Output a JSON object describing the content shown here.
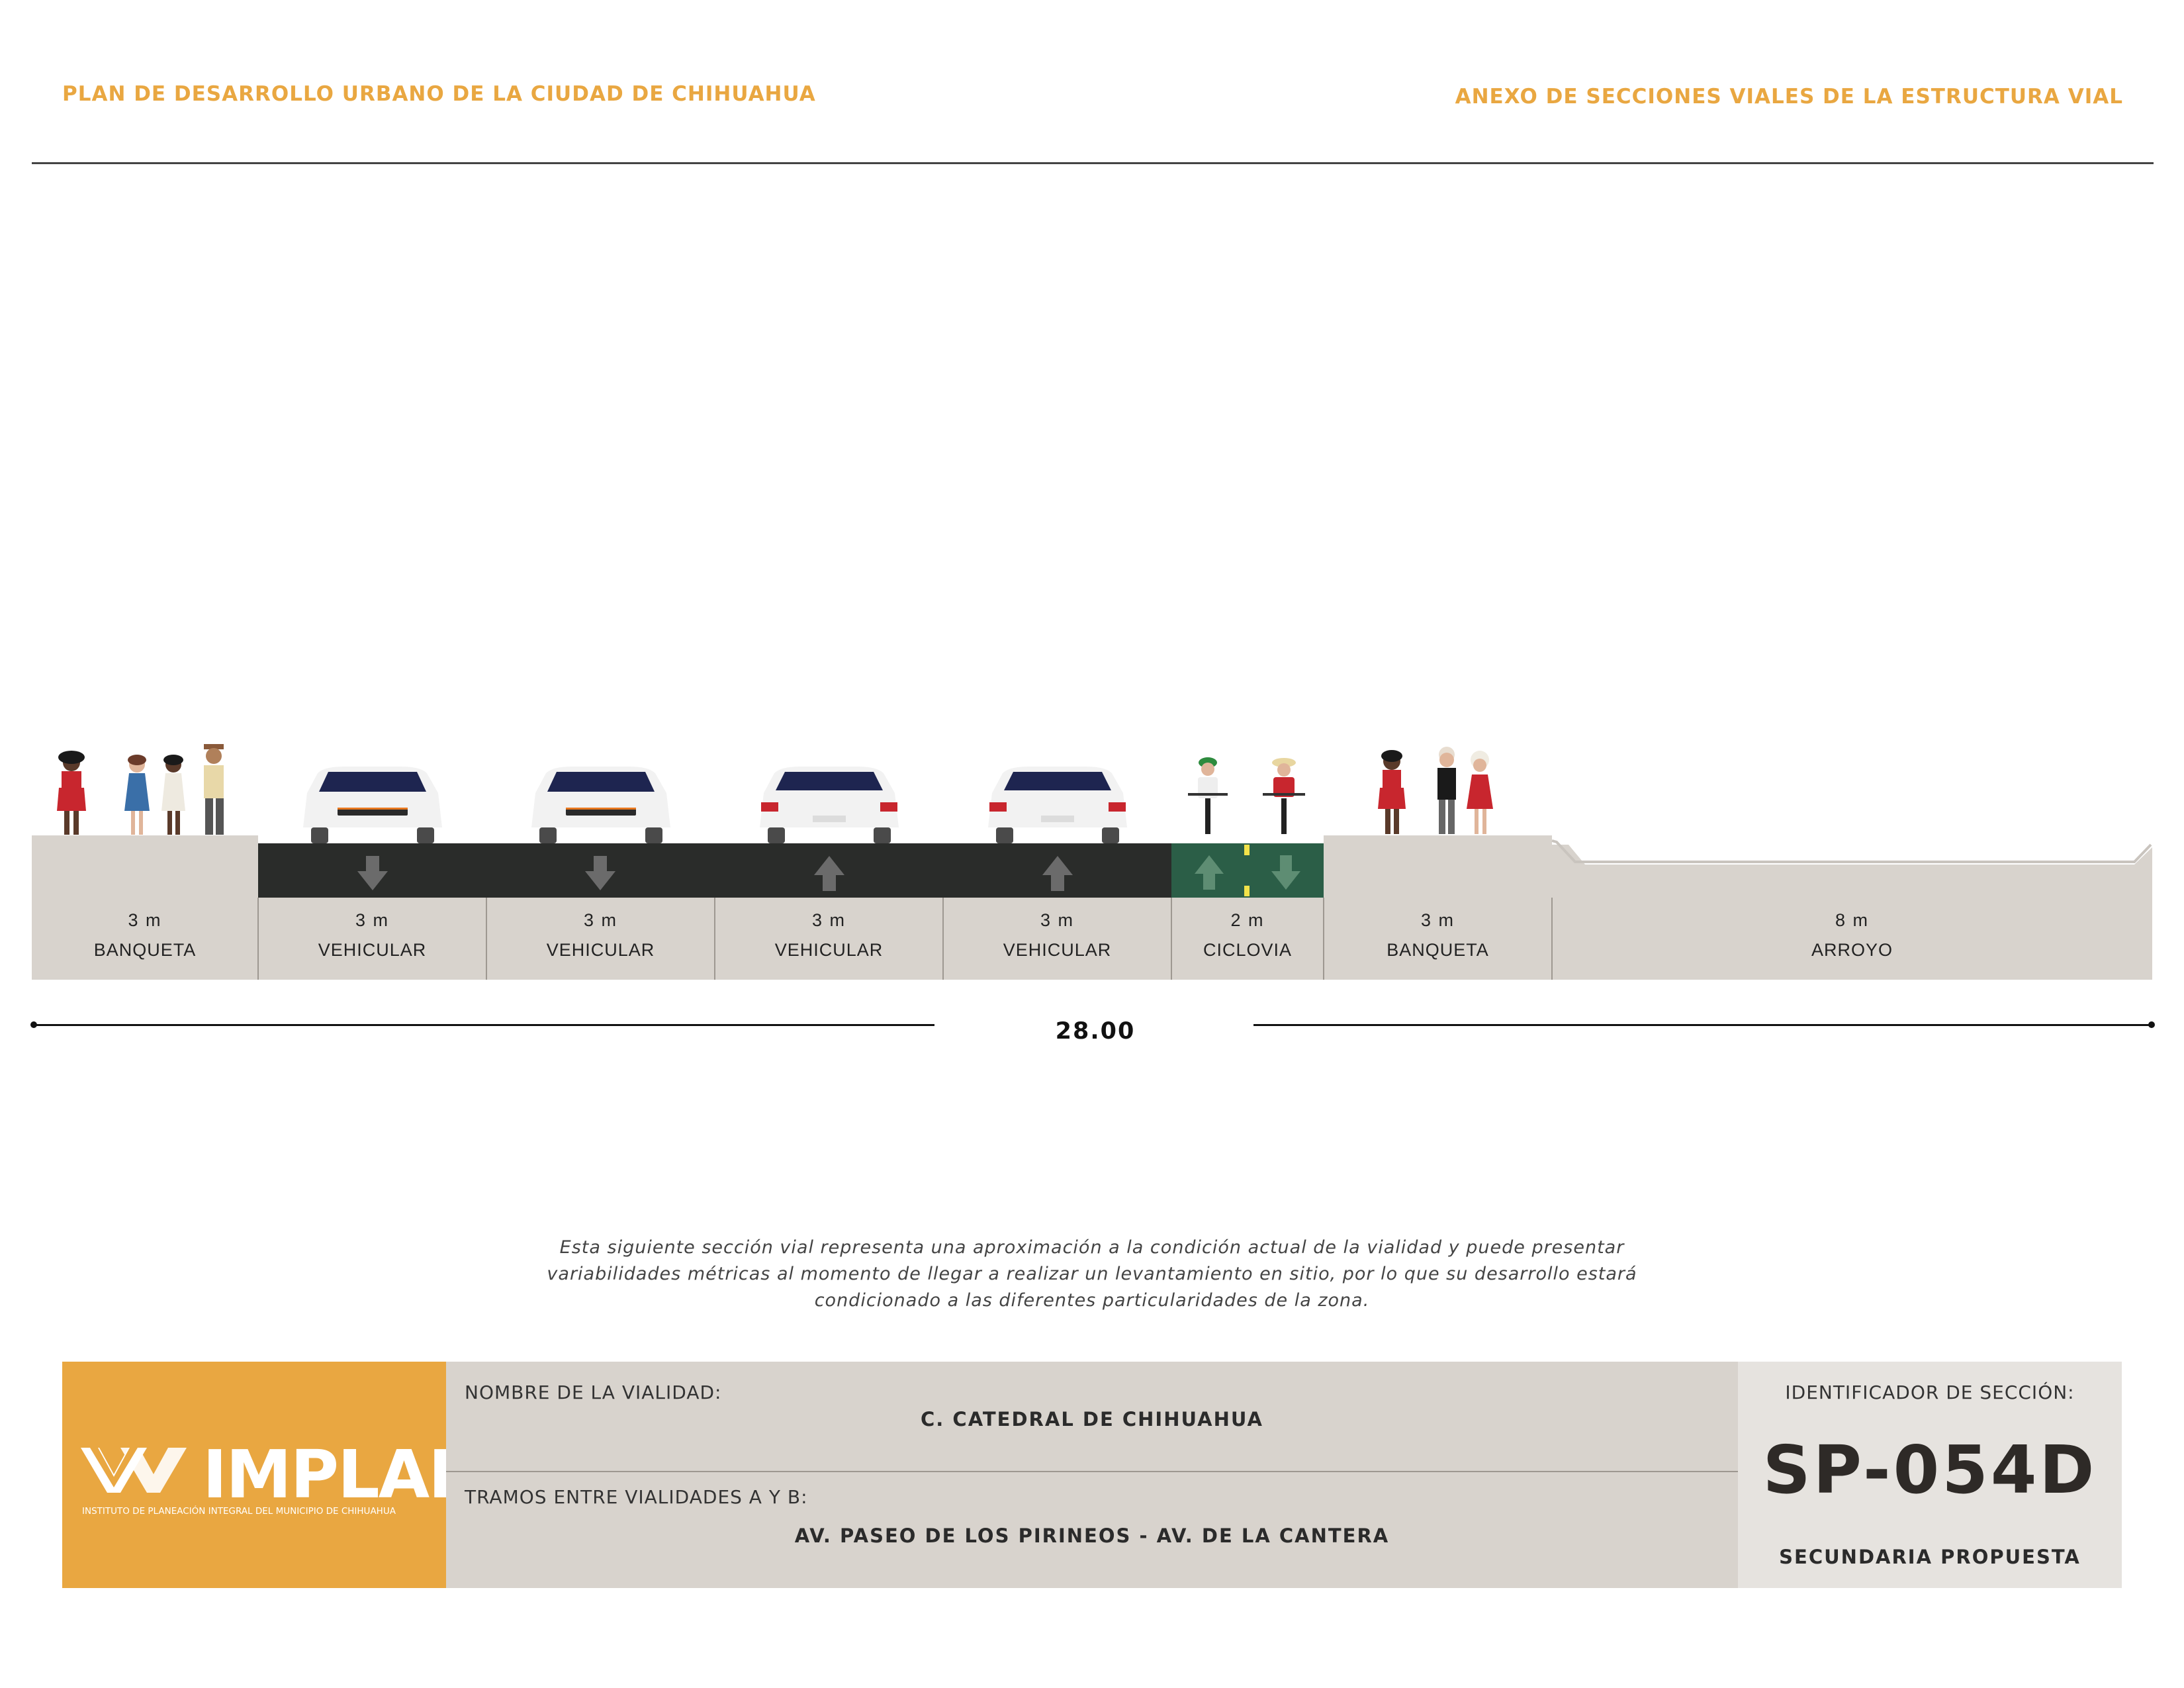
{
  "header": {
    "left_title": "PLAN DE DESARROLLO URBANO DE LA CIUDAD DE CHIHUAHUA",
    "right_title": "ANEXO DE SECCIONES VIALES DE LA ESTRUCTURA VIAL"
  },
  "colors": {
    "accent": "#e9a741",
    "asphalt": "#2a2c2a",
    "bike_lane": "#2b5e47",
    "sidewalk": "#d8d3cd",
    "info_bg": "#d8d3cd"
  },
  "section": {
    "segments": [
      {
        "width": "3 m",
        "name": "BANQUETA"
      },
      {
        "width": "3 m",
        "name": "VEHICULAR"
      },
      {
        "width": "3 m",
        "name": "VEHICULAR"
      },
      {
        "width": "3 m",
        "name": "VEHICULAR"
      },
      {
        "width": "3 m",
        "name": "VEHICULAR"
      },
      {
        "width": "2 m",
        "name": "CICLOVIA"
      },
      {
        "width": "3 m",
        "name": "BANQUETA"
      },
      {
        "width": "8 m",
        "name": "ARROYO"
      }
    ],
    "total_width": "28.00"
  },
  "disclaimer": "Esta siguiente sección vial representa una aproximación a la condición actual de la vialidad y puede presentar variabilidades métricas al momento de llegar a realizar un levantamiento en sitio, por lo que su desarrollo estará condicionado a las diferentes particularidades de la zona.",
  "logo": {
    "name": "IMPLAN",
    "subtitle": "INSTITUTO DE PLANEACIÓN INTEGRAL DEL MUNICIPIO DE CHIHUAHUA"
  },
  "info": {
    "road_label": "NOMBRE DE LA VIALIDAD:",
    "road_name": "C. CATEDRAL DE CHIHUAHUA",
    "segment_label": "TRAMOS ENTRE VIALIDADES A Y B:",
    "segment_value": "AV. PASEO DE LOS PIRINEOS - AV. DE LA CANTERA",
    "id_label": "IDENTIFICADOR DE SECCIÓN:",
    "id_value": "SP-054D",
    "id_type": "SECUNDARIA PROPUESTA"
  }
}
